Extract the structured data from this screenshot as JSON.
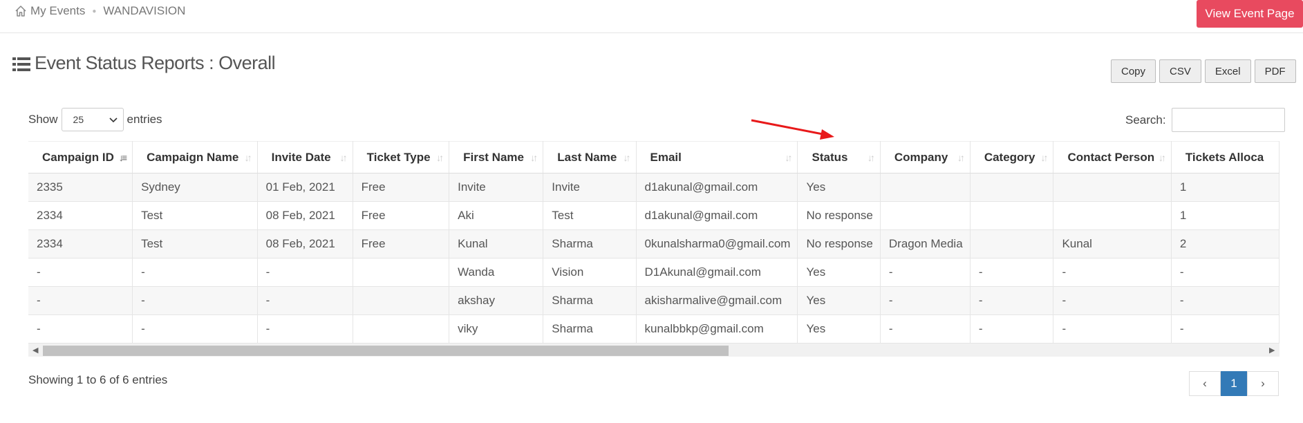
{
  "breadcrumb": {
    "home": "My Events",
    "current": "WANDAVISION"
  },
  "view_event_button": "View Event Page",
  "page_title": "Event Status Reports : Overall",
  "export_buttons": [
    "Copy",
    "CSV",
    "Excel",
    "PDF"
  ],
  "length": {
    "prefix": "Show",
    "value": "25",
    "suffix": "entries"
  },
  "search": {
    "label": "Search:",
    "value": ""
  },
  "table": {
    "columns": [
      "Campaign ID",
      "Campaign Name",
      "Invite Date",
      "Ticket Type",
      "First Name",
      "Last Name",
      "Email",
      "Status",
      "Company",
      "Category",
      "Contact Person",
      "Tickets Alloca"
    ],
    "sorted_column": "Campaign ID",
    "rows": [
      [
        "2335",
        "Sydney",
        "01 Feb, 2021",
        "Free",
        "Invite",
        "Invite",
        "d1akunal@gmail.com",
        "Yes",
        "",
        "",
        "",
        "1"
      ],
      [
        "2334",
        "Test",
        "08 Feb, 2021",
        "Free",
        "Aki",
        "Test",
        "d1akunal@gmail.com",
        "No response",
        "",
        "",
        "",
        "1"
      ],
      [
        "2334",
        "Test",
        "08 Feb, 2021",
        "Free",
        "Kunal",
        "Sharma",
        "0kunalsharma0@gmail.com",
        "No response",
        "Dragon Media",
        "",
        "Kunal",
        "2"
      ],
      [
        "-",
        "-",
        "-",
        "",
        "Wanda",
        "Vision",
        "D1Akunal@gmail.com",
        "Yes",
        "-",
        "-",
        "-",
        "-"
      ],
      [
        "-",
        "-",
        "-",
        "",
        "akshay",
        "Sharma",
        "akisharmalive@gmail.com",
        "Yes",
        "-",
        "-",
        "-",
        "-"
      ],
      [
        "-",
        "-",
        "-",
        "",
        "viky",
        "Sharma",
        "kunalbbkp@gmail.com",
        "Yes",
        "-",
        "-",
        "-",
        "-"
      ]
    ]
  },
  "info": "Showing 1 to 6 of 6 entries",
  "pagination": {
    "prev": "‹",
    "current": "1",
    "next": "›"
  },
  "colors": {
    "brand_red": "#e84a5f",
    "pager_blue": "#337ab7",
    "annotation": "#e8191a"
  },
  "icons": [
    "home-icon",
    "list-icon",
    "chevron-down-icon",
    "sort-icon",
    "arrow-left-icon",
    "arrow-right-icon"
  ]
}
